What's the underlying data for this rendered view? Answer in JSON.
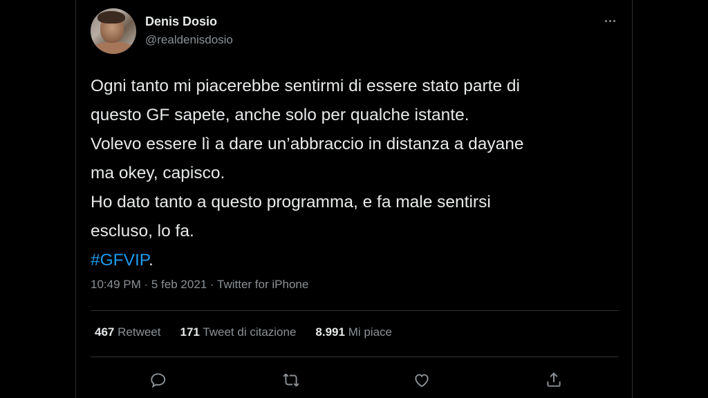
{
  "author": {
    "display_name": "Denis Dosio",
    "handle": "@realdenisdosio",
    "avatar_icon": "profile-photo"
  },
  "tweet": {
    "lines": [
      "Ogni tanto mi piacerebbe sentirmi di essere stato parte di",
      "questo GF sapete, anche solo per qualche istante.",
      "Volevo essere lì a dare un’abbraccio in distanza a dayane",
      "ma okey, capisco.",
      "Ho dato tanto a questo programma, e fa male sentirsi",
      "escluso, lo fa."
    ],
    "hashtag": "#GFVIP",
    "hashtag_suffix": ".",
    "meta": "10:49 PM · 5 feb 2021 · Twitter for iPhone"
  },
  "stats": {
    "retweets_count": "467",
    "retweets_label": "Retweet",
    "quotes_count": "171",
    "quotes_label": "Tweet di citazione",
    "likes_count": "8.991",
    "likes_label": "Mi piace"
  },
  "colors": {
    "background": "#000000",
    "primary_text": "#e7e9ea",
    "secondary_text": "#8b9196",
    "link": "#1d9bf0",
    "divider": "#2f3336"
  },
  "icons": [
    "more-icon",
    "reply-icon",
    "retweet-icon",
    "like-icon",
    "share-icon"
  ]
}
